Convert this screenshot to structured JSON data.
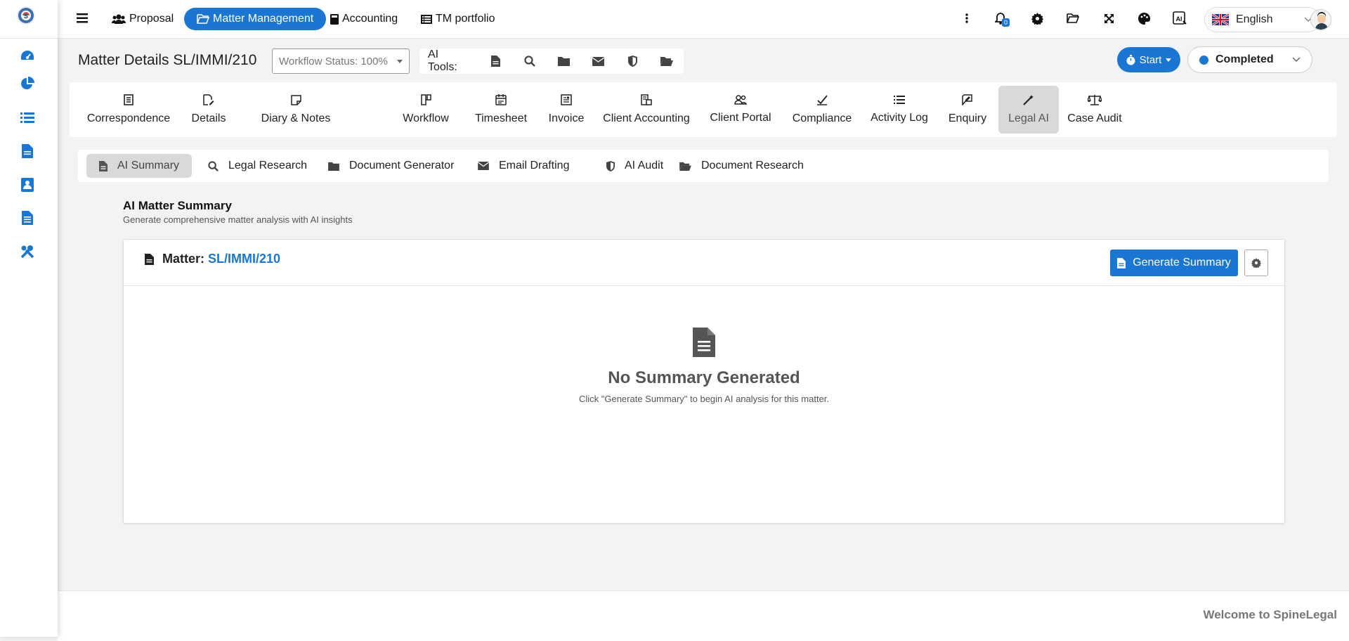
{
  "topnav": {
    "items": [
      {
        "label": "Proposal",
        "icon": "users-icon"
      },
      {
        "label": "Matter Management",
        "icon": "folder-open-icon",
        "active": true
      },
      {
        "label": "Accounting",
        "icon": "calculator-icon"
      },
      {
        "label": "TM portfolio",
        "icon": "list-alt-icon"
      }
    ],
    "notification_count": "0",
    "language": "English"
  },
  "header": {
    "title": "Matter Details SL/IMMI/210",
    "workflow_status": "Workflow Status: 100%",
    "ai_tools_label": "AI Tools:",
    "start_label": "Start",
    "status": "Completed"
  },
  "main_tabs": [
    {
      "label": "Correspondence",
      "icon": "document-icon"
    },
    {
      "label": "Details",
      "icon": "file-edit-icon"
    },
    {
      "label": "Diary & Notes",
      "icon": "note-icon"
    },
    {
      "label": "Workflow",
      "icon": "workflow-icon"
    },
    {
      "label": "Timesheet",
      "icon": "timesheet-icon"
    },
    {
      "label": "Invoice",
      "icon": "invoice-icon"
    },
    {
      "label": "Client Accounting",
      "icon": "client-accounting-icon"
    },
    {
      "label": "Client Portal",
      "icon": "client-portal-icon"
    },
    {
      "label": "Compliance",
      "icon": "compliance-icon"
    },
    {
      "label": "Activity Log",
      "icon": "list-icon"
    },
    {
      "label": "Enquiry",
      "icon": "enquiry-icon"
    },
    {
      "label": "Legal AI",
      "icon": "magic-wand-icon",
      "active": true
    },
    {
      "label": "Case Audit",
      "icon": "scale-icon"
    }
  ],
  "sub_tabs": [
    {
      "label": "AI Summary",
      "icon": "file-icon",
      "active": true
    },
    {
      "label": "Legal Research",
      "icon": "search-icon"
    },
    {
      "label": "Document Generator",
      "icon": "folder-icon"
    },
    {
      "label": "Email Drafting",
      "icon": "envelope-icon"
    },
    {
      "label": "AI Audit",
      "icon": "shield-icon"
    },
    {
      "label": "Document Research",
      "icon": "folder-open-icon"
    }
  ],
  "section": {
    "title": "AI Matter Summary",
    "subtitle": "Generate comprehensive matter analysis with AI insights"
  },
  "card": {
    "matter_label": "Matter:",
    "matter_code": "SL/IMMI/210",
    "generate_label": "Generate Summary",
    "empty_title": "No Summary Generated",
    "empty_text": "Click \"Generate Summary\" to begin AI analysis for this matter."
  },
  "footer": {
    "welcome": "Welcome to SpineLegal"
  },
  "colors": {
    "primary": "#1976d2",
    "active_tab_bg": "#d9d9d9"
  }
}
